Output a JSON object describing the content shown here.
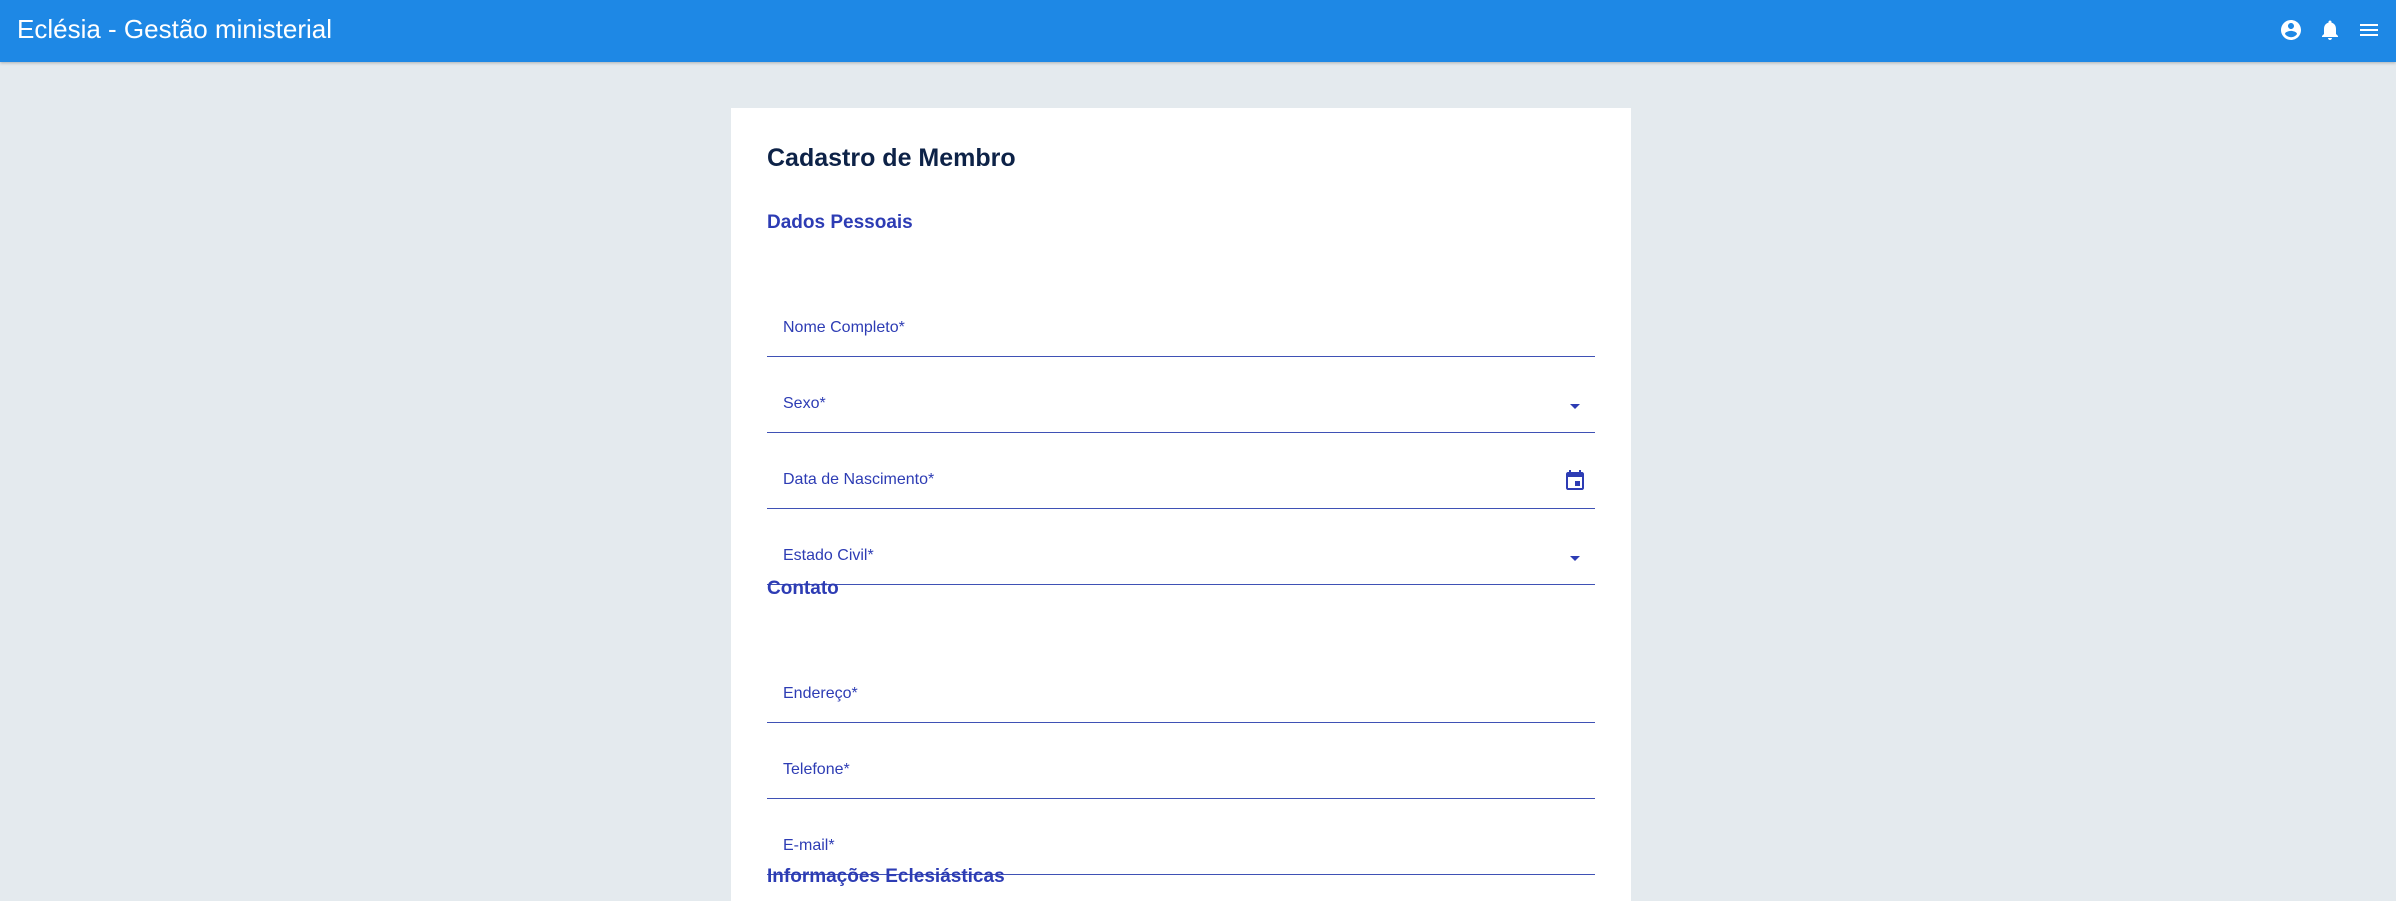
{
  "app": {
    "title": "Eclésia - Gestão ministerial"
  },
  "topbar": {
    "icons": [
      "account-circle-icon",
      "notifications-bell-icon",
      "menu-icon"
    ]
  },
  "form": {
    "title": "Cadastro de Membro",
    "sections": {
      "personal": {
        "title": "Dados Pessoais",
        "fields": {
          "full_name": {
            "label": "Nome Completo*",
            "value": ""
          },
          "sex": {
            "label": "Sexo*",
            "value": "",
            "icon": "dropdown-arrow-icon"
          },
          "birth_date": {
            "label": "Data de Nascimento*",
            "value": "",
            "icon": "calendar-icon"
          },
          "marital_status": {
            "label": "Estado Civil*",
            "value": "",
            "icon": "dropdown-arrow-icon"
          }
        }
      },
      "contact": {
        "title": "Contato",
        "fields": {
          "address": {
            "label": "Endereço*",
            "value": ""
          },
          "phone": {
            "label": "Telefone*",
            "value": ""
          },
          "email": {
            "label": "E-mail*",
            "value": ""
          }
        }
      },
      "ecclesiastical": {
        "title": "Informações Eclesiásticas"
      }
    }
  },
  "colors": {
    "topbar": "#1e88e5",
    "background": "#e4eaee",
    "card": "#ffffff",
    "accent": "#3f51b5",
    "label": "#2d3cb4",
    "title": "#0d2247"
  }
}
